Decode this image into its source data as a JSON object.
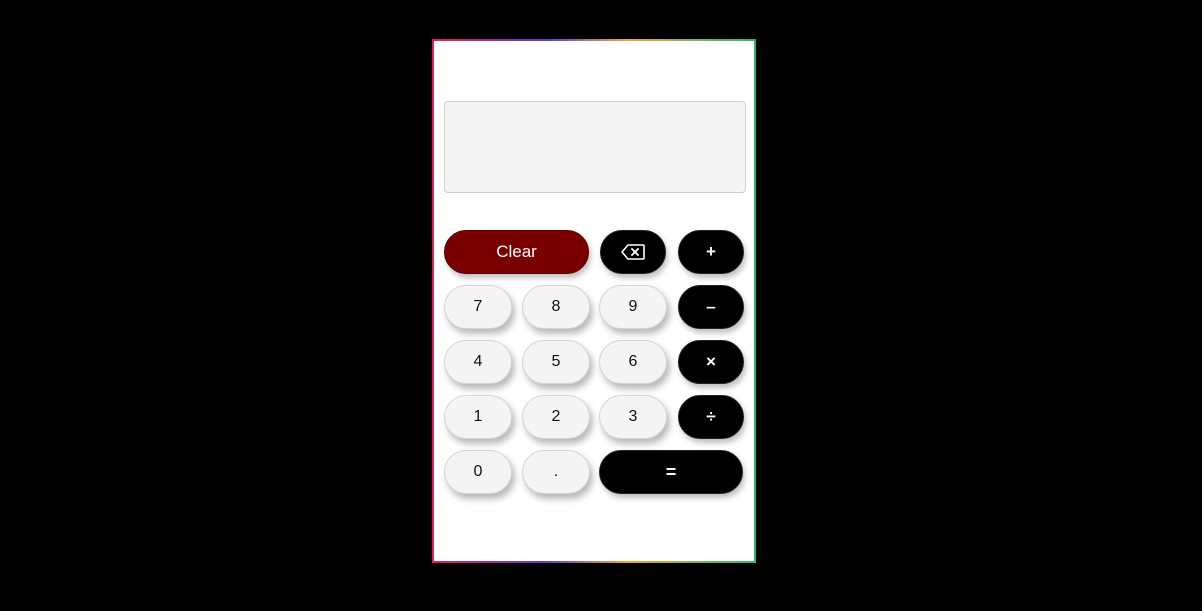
{
  "display": {
    "value": ""
  },
  "keys": {
    "clear": "Clear",
    "backspace_icon": "backspace-icon",
    "add": "+",
    "subtract": "–",
    "multiply": "×",
    "divide": "÷",
    "equals": "=",
    "dot": ".",
    "digits": {
      "d0": "0",
      "d1": "1",
      "d2": "2",
      "d3": "3",
      "d4": "4",
      "d5": "5",
      "d6": "6",
      "d7": "7",
      "d8": "8",
      "d9": "9"
    }
  },
  "colors": {
    "clear_bg": "#7a0000",
    "operator_bg": "#000000",
    "number_bg": "#f4f4f4",
    "display_bg": "#f4f4f4"
  }
}
